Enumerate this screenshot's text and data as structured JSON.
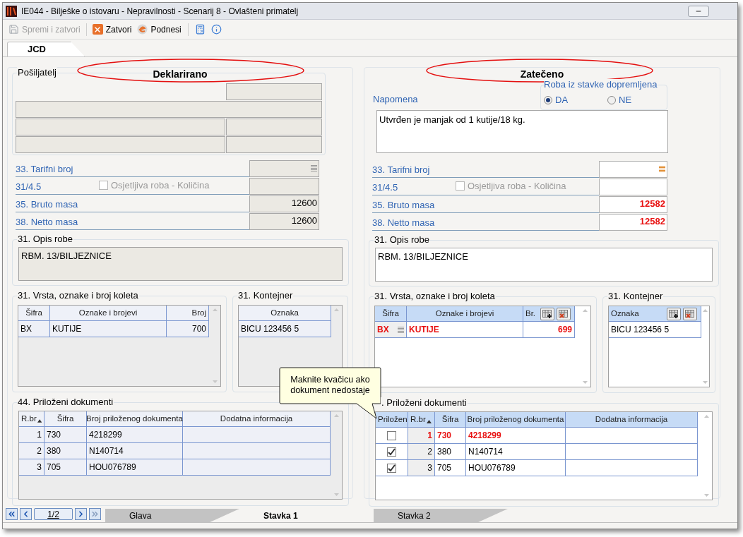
{
  "window": {
    "title": "IE044 - Bilješke o istovaru - Nepravilnosti - Scenarij 8 - Ovlašteni primatelj"
  },
  "toolbar": [
    {
      "kind": "save",
      "label": "Spremi i zatvori",
      "disabled": true
    },
    {
      "kind": "close",
      "label": "Zatvori",
      "disabled": false
    },
    {
      "kind": "submit",
      "label": "Podnesi",
      "disabled": false
    },
    {
      "kind": "calculator",
      "disabled": false
    },
    {
      "kind": "info",
      "disabled": false
    }
  ],
  "top_tabs": [
    {
      "label": "JCD",
      "selected": true
    }
  ],
  "declared": {
    "heading": "Deklarirano",
    "editable": false,
    "sender_label": "Pošiljatelj",
    "fields": [
      {
        "kind": "lookup",
        "label": "33. Tarifni broj"
      },
      {
        "kind": "checkbox",
        "label": "31/4.5",
        "checkbox": {
          "label": "Osjetljiva roba - Količina",
          "checked": false,
          "disabled": true
        }
      },
      {
        "kind": "plain",
        "label": "35. Bruto masa",
        "value": "12600",
        "changed": false
      },
      {
        "kind": "plain",
        "label": "38. Netto masa",
        "value": "12600",
        "changed": false
      }
    ],
    "description": {
      "legend": "31. Opis robe",
      "text": "RBM. 13/BILJEZNICE"
    },
    "packages": {
      "legend": "31. Vrsta, oznake i broj koleta",
      "columns": [
        {
          "label": "Šifra",
          "kind": "text"
        },
        {
          "label": "Oznake i brojevi",
          "kind": "text"
        },
        {
          "label": "Broj",
          "kind": "number"
        }
      ],
      "rows": [
        {
          "cells": [
            "BX",
            "KUTIJE",
            "700"
          ],
          "changed": false
        }
      ]
    },
    "container": {
      "legend": "31. Kontejner",
      "columns": [
        {
          "label": "Oznaka"
        }
      ],
      "rows": [
        {
          "cells": [
            "BICU 123456 5"
          ],
          "changed": false
        }
      ]
    },
    "documents": {
      "legend": "44. Priloženi dokumenti",
      "columns": [
        {
          "label": "R.br",
          "kind": "index",
          "sorted": true
        },
        {
          "label": "Šifra",
          "kind": "text",
          "sorted": false
        },
        {
          "label": "Broj priloženog dokumenta",
          "kind": "text",
          "sorted": false
        },
        {
          "label": "Dodatna informacija",
          "kind": "text",
          "sorted": false
        }
      ],
      "rows": [
        {
          "cells": [
            "1",
            "730",
            "4218299"
          ],
          "changed": false
        },
        {
          "cells": [
            "2",
            "380",
            "N140714"
          ],
          "changed": false
        },
        {
          "cells": [
            "3",
            "705",
            "HOU076789"
          ],
          "changed": false
        }
      ]
    }
  },
  "found": {
    "heading": "Zatečeno",
    "editable": true,
    "note": {
      "label": "Napomena",
      "text": "Utvrđen je manjak od 1 kutije/18 kg."
    },
    "delivered": {
      "legend": "Roba iz stavke dopremljena",
      "options": [
        {
          "label": "DA",
          "selected": true
        },
        {
          "label": "NE",
          "selected": false
        }
      ]
    },
    "fields": [
      {
        "kind": "lookup",
        "label": "33. Tarifni broj"
      },
      {
        "kind": "checkbox",
        "label": "31/4.5",
        "checkbox": {
          "label": "Osjetljiva roba - Količina",
          "checked": false,
          "disabled": true
        }
      },
      {
        "kind": "plain",
        "label": "35. Bruto masa",
        "value": "12582",
        "changed": true
      },
      {
        "kind": "plain",
        "label": "38. Netto masa",
        "value": "12582",
        "changed": true
      }
    ],
    "description": {
      "legend": "31. Opis robe",
      "text": "RBM. 13/BILJEZNICE"
    },
    "packages": {
      "legend": "31. Vrsta, oznake i broj koleta",
      "columns": [
        {
          "label": "Šifra",
          "kind": "lookup"
        },
        {
          "label": "Oznake i brojevi",
          "kind": "text"
        },
        {
          "label": "Br.",
          "kind": "number"
        }
      ],
      "rows": [
        {
          "cells": [
            "BX",
            "KUTIJE",
            "699"
          ],
          "changed": true
        }
      ]
    },
    "container": {
      "legend": "31. Kontejner",
      "columns": [
        {
          "label": "Oznaka"
        }
      ],
      "rows": [
        {
          "cells": [
            "BICU 123456 5"
          ],
          "changed": false
        }
      ]
    },
    "documents": {
      "legend": ". Priloženi dokumenti",
      "columns": [
        {
          "label": "Priložen",
          "kind": "check"
        },
        {
          "label": "R.br",
          "kind": "index",
          "sorted": true
        },
        {
          "label": "Šifra",
          "kind": "text",
          "sorted": false
        },
        {
          "label": "Broj priloženog dokumenta",
          "kind": "text",
          "sorted": false
        },
        {
          "label": "Dodatna informacija",
          "kind": "text",
          "sorted": false
        }
      ],
      "rows": [
        {
          "attached": false,
          "cells": [
            "",
            "1",
            "730",
            "4218299"
          ],
          "changed": true
        },
        {
          "attached": true,
          "cells": [
            "",
            "2",
            "380",
            "N140714"
          ],
          "changed": false
        },
        {
          "attached": true,
          "cells": [
            "",
            "3",
            "705",
            "HOU076789"
          ],
          "changed": false
        }
      ]
    }
  },
  "tooltip": {
    "text": "Maknite kvačicu ako dokument nedostaje"
  },
  "pager": {
    "page": "1/2"
  },
  "bottom_tabs": [
    {
      "label": "Glava",
      "selected": false
    },
    {
      "label": "Stavka 1",
      "selected": true
    },
    {
      "label": "Stavka 2",
      "selected": false
    }
  ]
}
